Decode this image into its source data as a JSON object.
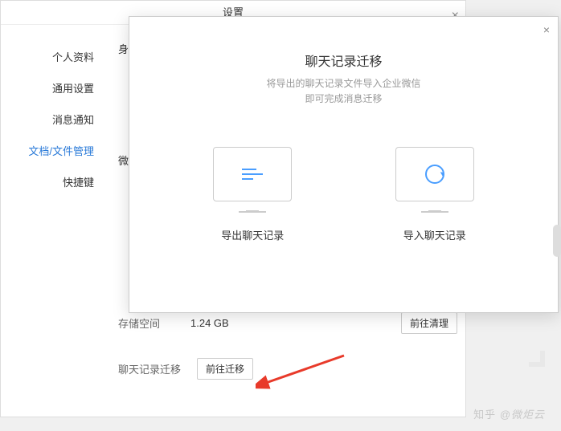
{
  "settings": {
    "title": "设置",
    "sidebar": [
      {
        "label": "个人资料"
      },
      {
        "label": "通用设置"
      },
      {
        "label": "消息通知"
      },
      {
        "label": "文档/文件管理"
      },
      {
        "label": "快捷键"
      }
    ],
    "rows": {
      "partial1": "身",
      "partial2": "微文",
      "storage_label": "存储空间",
      "storage_value": "1.24 GB",
      "storage_btn": "前往清理",
      "migrate_label": "聊天记录迁移",
      "migrate_btn": "前往迁移"
    }
  },
  "modal": {
    "title": "聊天记录迁移",
    "subtitle_line1": "将导出的聊天记录文件导入企业微信",
    "subtitle_line2": "即可完成消息迁移",
    "export_label": "导出聊天记录",
    "import_label": "导入聊天记录"
  },
  "watermark": {
    "text": "@微炬云"
  }
}
